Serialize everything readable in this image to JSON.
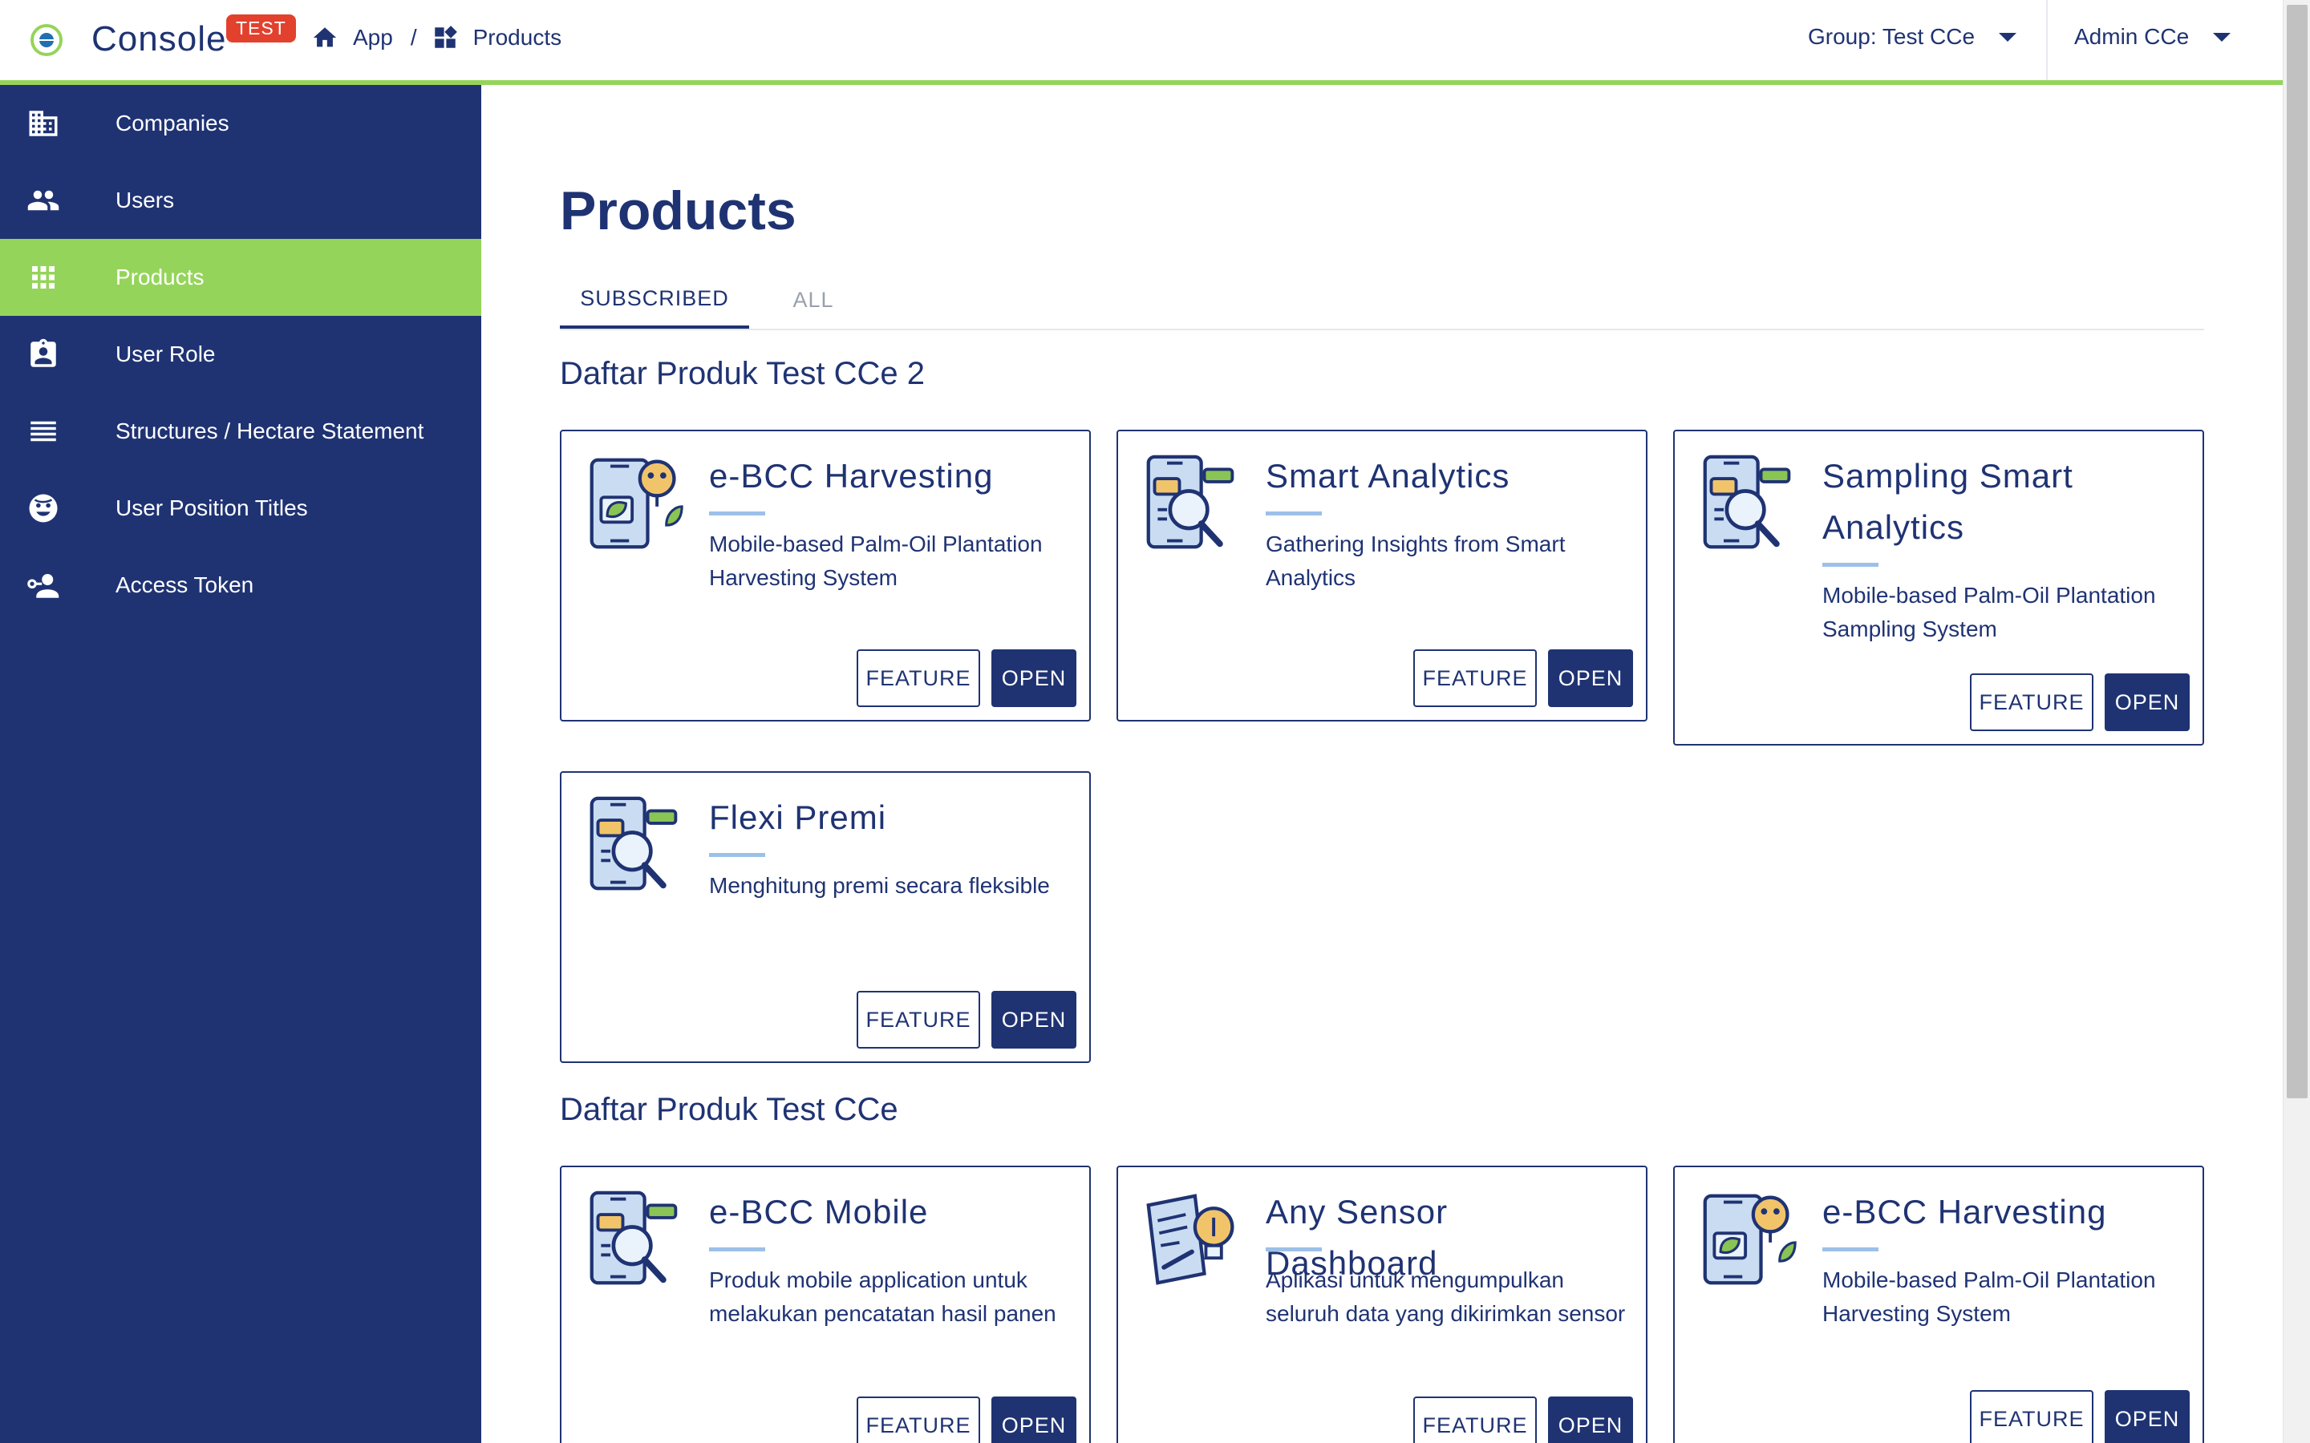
{
  "header": {
    "app_name": "Console",
    "env_badge": "TEST",
    "breadcrumb": [
      "App",
      "/",
      "Products"
    ],
    "group_selector": "Group: Test CCe",
    "user_menu": "Admin CCe"
  },
  "colors": {
    "primary": "#1f3373",
    "accent": "#95d45a",
    "badge": "#e2412e",
    "underline": "#9cc0e8"
  },
  "sidebar": {
    "items": [
      {
        "label": "Companies",
        "icon": "building-icon"
      },
      {
        "label": "Users",
        "icon": "people-icon"
      },
      {
        "label": "Products",
        "icon": "apps-grid-icon",
        "active": true
      },
      {
        "label": "User Role",
        "icon": "badge-icon"
      },
      {
        "label": "Structures / Hectare Statement",
        "icon": "list-icon"
      },
      {
        "label": "User Position Titles",
        "icon": "face-icon"
      },
      {
        "label": "Access Token",
        "icon": "person-key-icon"
      }
    ]
  },
  "main": {
    "title": "Products",
    "tabs": [
      {
        "label": "SUBSCRIBED",
        "active": true
      },
      {
        "label": "ALL",
        "active": false
      }
    ],
    "groups": [
      {
        "title": "Daftar Produk Test CCe 2",
        "products": [
          {
            "name": "e-BCC Harvesting",
            "description": "Mobile-based Palm-Oil Plantation Harvesting System",
            "icon": "phone-leaf-bulb-icon"
          },
          {
            "name": "Smart Analytics",
            "description": "Gathering Insights from Smart Analytics",
            "icon": "phone-magnifier-icon"
          },
          {
            "name": "Sampling Smart Analytics",
            "description": "Mobile-based Palm-Oil Plantation Sampling System",
            "icon": "phone-magnifier-icon"
          },
          {
            "name": "Flexi Premi",
            "description": "Menghitung premi secara fleksible",
            "icon": "phone-magnifier-icon"
          }
        ]
      },
      {
        "title": "Daftar Produk Test CCe",
        "products": [
          {
            "name": "e-BCC Mobile",
            "description": "Produk mobile application untuk melakukan pencatatan hasil panen",
            "icon": "phone-magnifier-icon"
          },
          {
            "name": "Any Sensor Dashboard",
            "description": "Aplikasi untuk mengumpulkan seluruh data yang dikirimkan sensor",
            "icon": "document-bulb-icon"
          },
          {
            "name": "e-BCC Harvesting",
            "description": "Mobile-based Palm-Oil Plantation Harvesting System",
            "icon": "phone-leaf-bulb-icon"
          }
        ]
      }
    ],
    "feature_label": "FEATURE",
    "open_label": "OPEN"
  }
}
